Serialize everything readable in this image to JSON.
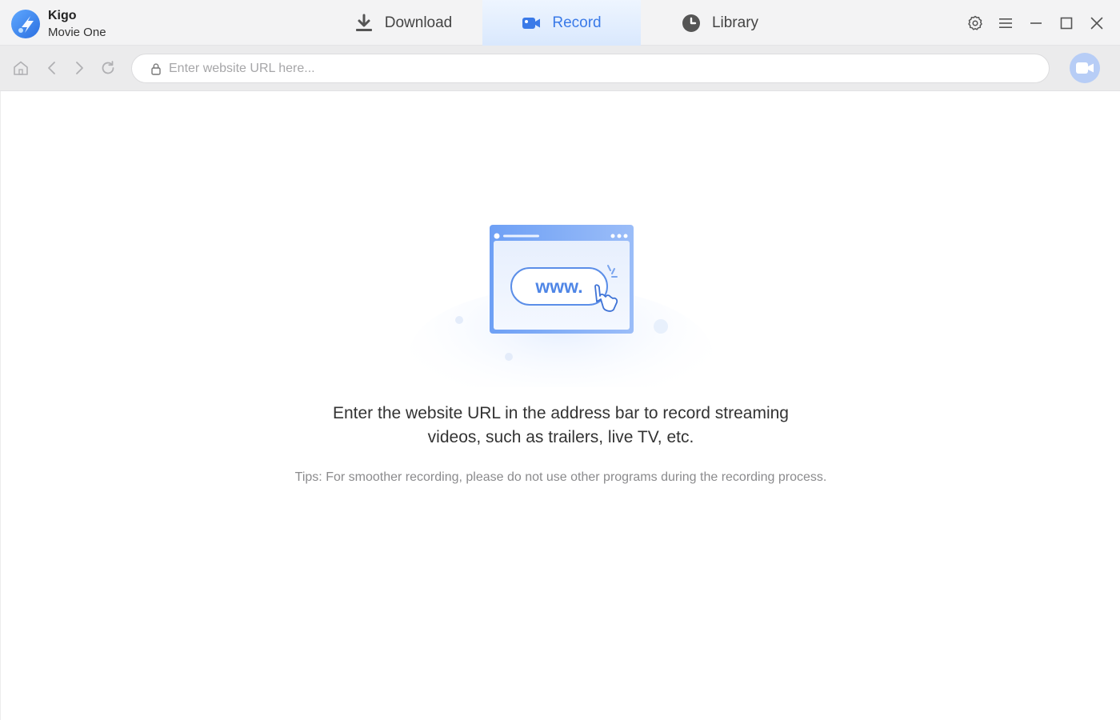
{
  "app": {
    "name": "Kigo",
    "subtitle": "Movie One"
  },
  "tabs": [
    {
      "label": "Download",
      "icon": "download-icon",
      "active": false
    },
    {
      "label": "Record",
      "icon": "record-camera-icon",
      "active": true
    },
    {
      "label": "Library",
      "icon": "clock-icon",
      "active": false
    }
  ],
  "window_controls": [
    "gear-icon",
    "menu-icon",
    "minimize-icon",
    "maximize-icon",
    "close-icon"
  ],
  "nav": {
    "icons": [
      "home-icon",
      "back-icon",
      "forward-icon",
      "refresh-icon"
    ]
  },
  "urlbar": {
    "value": "",
    "placeholder": "Enter website URL here..."
  },
  "illustration": {
    "text": "www."
  },
  "main": {
    "message_line1": "Enter the website URL in the address bar to record streaming",
    "message_line2": "videos, such as trailers, live TV, etc.",
    "tips": "Tips: For smoother recording, please do not use other programs during the recording process."
  },
  "colors": {
    "accent": "#3a7ae8",
    "titlebar_bg": "#f3f3f4",
    "navbar_bg": "#ebebec",
    "record_button_bg": "#b7cdf6"
  }
}
